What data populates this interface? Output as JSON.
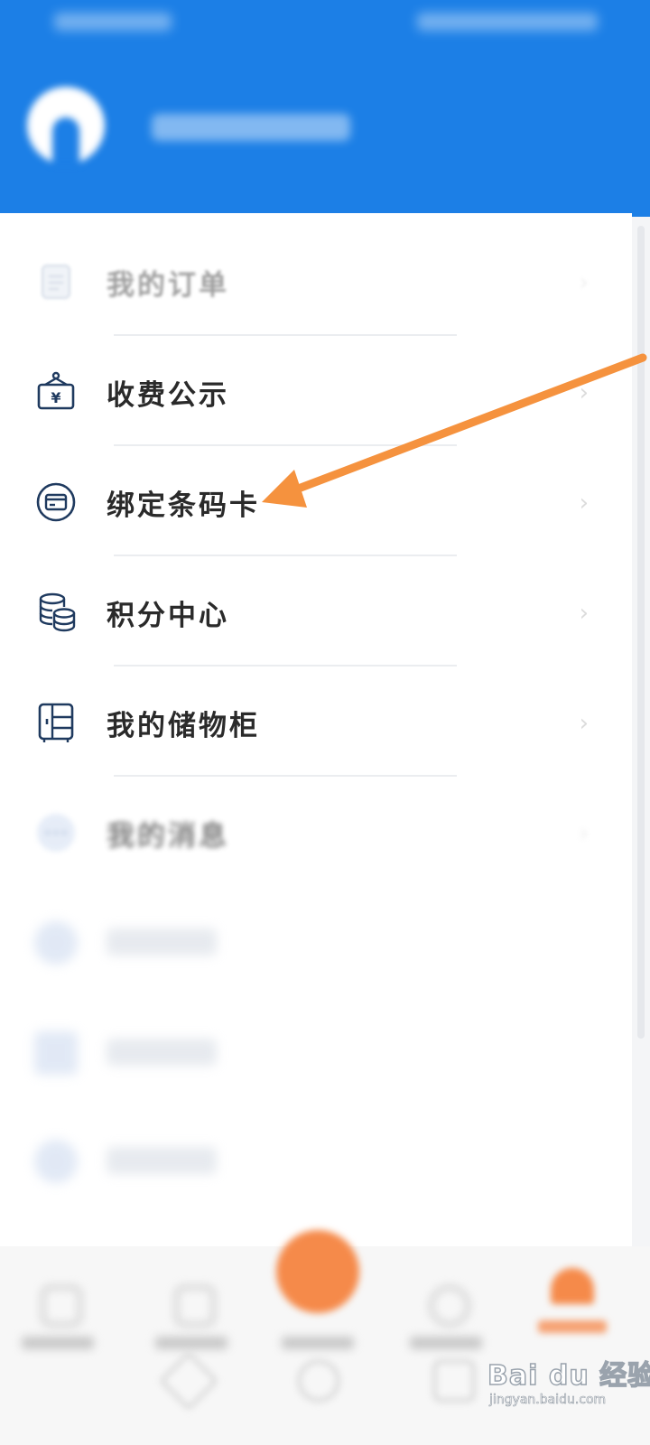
{
  "menu": {
    "items": [
      {
        "label": "我的订单",
        "icon": "order-icon"
      },
      {
        "label": "收费公示",
        "icon": "fee-notice-icon"
      },
      {
        "label": "绑定条码卡",
        "icon": "barcode-card-icon"
      },
      {
        "label": "积分中心",
        "icon": "points-coins-icon"
      },
      {
        "label": "我的储物柜",
        "icon": "locker-icon"
      },
      {
        "label": "我的消息",
        "icon": "message-icon"
      }
    ]
  },
  "watermark": {
    "main": "Bai du 经验",
    "sub": "jingyan.baidu.com"
  },
  "colors": {
    "header_blue": "#1c7fe6",
    "icon_navy": "#1f3a5f",
    "accent_orange": "#f5923e"
  }
}
